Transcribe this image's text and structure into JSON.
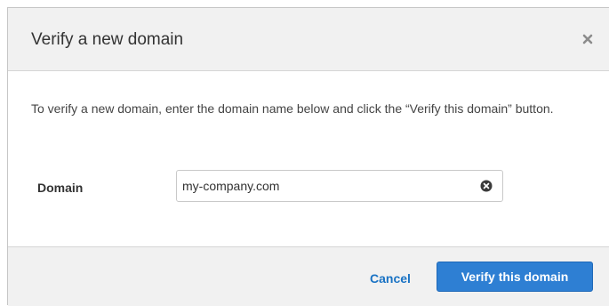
{
  "dialog": {
    "title": "Verify a new domain",
    "close_icon": "close-x-icon",
    "description": "To verify a new domain, enter the domain name below and click the “Verify this domain” button.",
    "domain_label": "Domain",
    "domain_value": "my-company.com",
    "clear_icon": "clear-circle-x-icon",
    "cancel_label": "Cancel",
    "verify_label": "Verify this domain"
  },
  "colors": {
    "header_bg": "#f1f1f1",
    "primary_button": "#2e7fd3",
    "link": "#1a73c4"
  }
}
